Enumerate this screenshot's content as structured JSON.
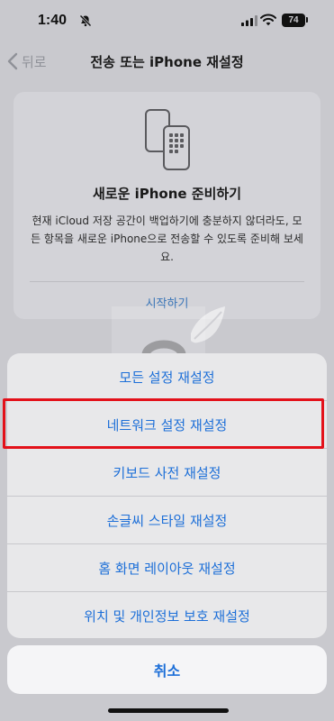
{
  "status_bar": {
    "time": "1:40",
    "battery": "74",
    "icons": [
      "bell-slash-icon",
      "cellular-signal-icon",
      "wifi-icon",
      "battery-icon"
    ]
  },
  "nav": {
    "back_label": "뒤로",
    "title": "전송 또는 iPhone 재설정"
  },
  "card": {
    "icon": "phone-transfer-icon",
    "title": "새로운 iPhone 준비하기",
    "description": "현재 iCloud 저장 공간이 백업하기에 충분하지 않더라도, 모든 항목을 새로운 iPhone으로 전송할 수 있도록 준비해 보세요.",
    "link": "시작하기"
  },
  "action_sheet": {
    "items": [
      {
        "label": "모든 설정 재설정"
      },
      {
        "label": "네트워크 설정 재설정",
        "highlighted": true
      },
      {
        "label": "키보드 사전 재설정"
      },
      {
        "label": "손글씨 스타일 재설정"
      },
      {
        "label": "홈 화면 레이아웃 재설정"
      },
      {
        "label": "위치 및 개인정보 보호 재설정"
      }
    ],
    "cancel": "취소"
  },
  "colors": {
    "accent": "#1d6fd8",
    "highlight": "#e3111a",
    "dimmed_background": "#c9c9ce"
  }
}
